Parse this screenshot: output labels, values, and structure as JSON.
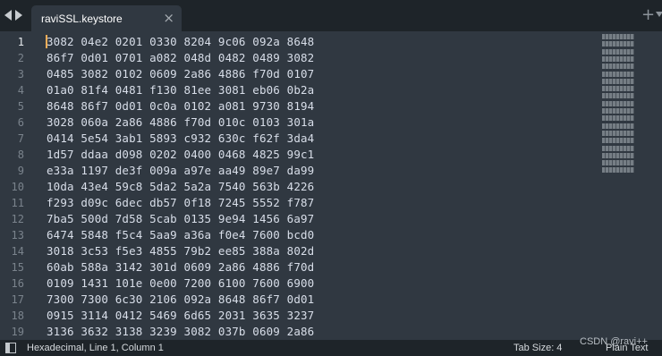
{
  "tabs": [
    {
      "title": "raviSSL.keystore",
      "close": "×"
    }
  ],
  "tab_add": "+",
  "editor": {
    "line_numbers": [
      "1",
      "2",
      "3",
      "4",
      "5",
      "6",
      "7",
      "8",
      "9",
      "10",
      "11",
      "12",
      "13",
      "14",
      "15",
      "16",
      "17",
      "18",
      "19"
    ],
    "lines": [
      "3082 04e2 0201 0330 8204 9c06 092a 8648",
      "86f7 0d01 0701 a082 048d 0482 0489 3082",
      "0485 3082 0102 0609 2a86 4886 f70d 0107",
      "01a0 81f4 0481 f130 81ee 3081 eb06 0b2a",
      "8648 86f7 0d01 0c0a 0102 a081 9730 8194",
      "3028 060a 2a86 4886 f70d 010c 0103 301a",
      "0414 5e54 3ab1 5893 c932 630c f62f 3da4",
      "1d57 ddaa d098 0202 0400 0468 4825 99c1",
      "e33a 1197 de3f 009a a97e aa49 89e7 da99",
      "10da 43e4 59c8 5da2 5a2a 7540 563b 4226",
      "f293 d09c 6dec db57 0f18 7245 5552 f787",
      "7ba5 500d 7d58 5cab 0135 9e94 1456 6a97",
      "6474 5848 f5c4 5aa9 a36a f0e4 7600 bcd0",
      "3018 3c53 f5e3 4855 79b2 ee85 388a 802d",
      "60ab 588a 3142 301d 0609 2a86 4886 f70d",
      "0109 1431 101e 0e00 7200 6100 7600 6900",
      "7300 7300 6c30 2106 092a 8648 86f7 0d01",
      "0915 3114 0412 5469 6d65 2031 3635 3237",
      "3136 3632 3138 3239 3082 037b 0609 2a86"
    ]
  },
  "status": {
    "position": "Hexadecimal, Line 1, Column 1",
    "tab_size": "Tab Size: 4",
    "syntax": "Plain Text"
  },
  "watermark": "CSDN @ravi++"
}
